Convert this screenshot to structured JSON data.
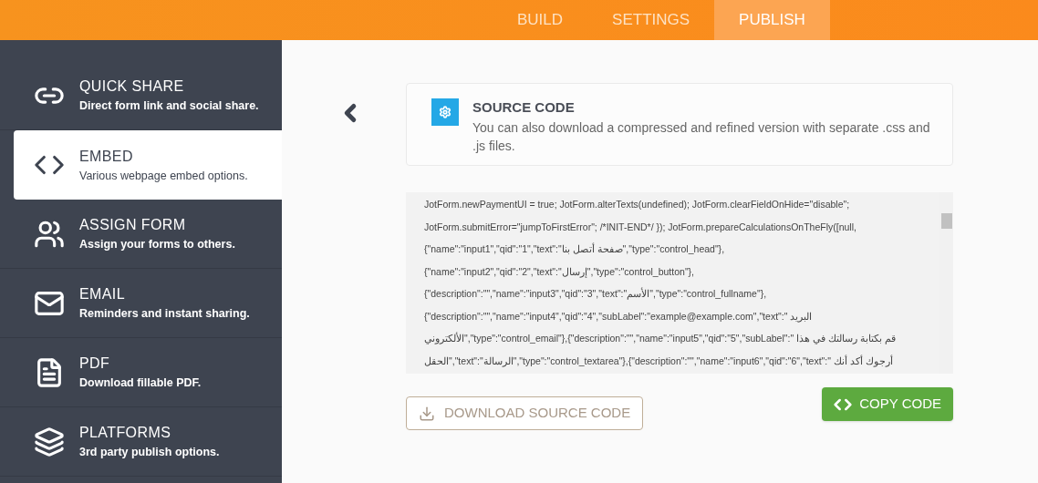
{
  "tabs": [
    {
      "label": "BUILD",
      "selected": false
    },
    {
      "label": "SETTINGS",
      "selected": false
    },
    {
      "label": "PUBLISH",
      "selected": true
    }
  ],
  "sidebar": {
    "items": [
      {
        "kind": "link",
        "title": "QUICK SHARE",
        "subtitle": "Direct form link and social share.",
        "selected": false
      },
      {
        "kind": "code",
        "title": "EMBED",
        "subtitle": "Various webpage embed options.",
        "selected": true
      },
      {
        "kind": "users",
        "title": "ASSIGN FORM",
        "subtitle": "Assign your forms to others.",
        "selected": false
      },
      {
        "kind": "mail",
        "title": "EMAIL",
        "subtitle": "Reminders and instant sharing.",
        "selected": false
      },
      {
        "kind": "pdf",
        "title": "PDF",
        "subtitle": "Download fillable PDF.",
        "selected": false
      },
      {
        "kind": "layers",
        "title": "PLATFORMS",
        "subtitle": "3rd party publish options.",
        "selected": false
      }
    ]
  },
  "info_card": {
    "title": "SOURCE CODE",
    "description": "You can also download a compressed and refined version with separate .css and .js files."
  },
  "code_lines": [
    "JotForm.newPaymentUI = true; JotForm.alterTexts(undefined); JotForm.clearFieldOnHide=\"disable\";",
    "JotForm.submitError=\"jumpToFirstError\"; /*INIT-END*/ }); JotForm.prepareCalculationsOnTheFly([null,",
    "{\"name\":\"input1\",\"qid\":\"1\",\"text\":\"صفحة أتصل بنا\",\"type\":\"control_head\"},",
    "{\"name\":\"input2\",\"qid\":\"2\",\"text\":\"إرسال\",\"type\":\"control_button\"},",
    "{\"description\":\"\",\"name\":\"input3\",\"qid\":\"3\",\"text\":\"الأسم\",\"type\":\"control_fullname\"},",
    "{\"description\":\"\",\"name\":\"input4\",\"qid\":\"4\",\"subLabel\":\"example@example.com\",\"text\":\" البريد",
    "الألكتروني\",\"type\":\"control_email\"},{\"description\":\"\",\"name\":\"input5\",\"qid\":\"5\",\"subLabel\":\" قم بكتابة رسالتك في هذا",
    "الحقل\",\"text\":\"الرسالة\",\"type\":\"control_textarea\"},{\"description\":\"\",\"name\":\"input6\",\"qid\":\"6\",\"text\":\" أرجوك أكد أنك"
  ],
  "buttons": {
    "download": "DOWNLOAD SOURCE CODE",
    "copy": "COPY CODE"
  }
}
